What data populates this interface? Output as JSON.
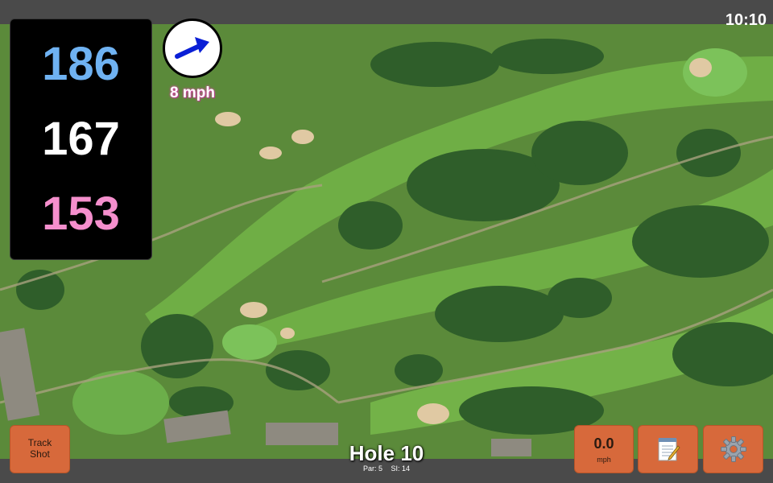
{
  "status_bar": {
    "time": "10:10"
  },
  "distances": {
    "back": "186",
    "center": "167",
    "front": "153"
  },
  "wind": {
    "speed": "8 mph",
    "direction_icon": "arrow-icon"
  },
  "buttons": {
    "track_shot_line1": "Track",
    "track_shot_line2": "Shot",
    "speed_value": "0.0",
    "speed_unit": "mph",
    "notes_icon": "notepad-icon",
    "settings_icon": "gear-icon"
  },
  "hole": {
    "title": "Hole 10",
    "par": "Par: 5",
    "si": "SI: 14"
  },
  "colors": {
    "back_distance": "#6fb2f2",
    "center_distance": "#ffffff",
    "front_distance": "#f58fcd",
    "button": "#d7693b",
    "wind_arrow": "#0a1fd6"
  }
}
